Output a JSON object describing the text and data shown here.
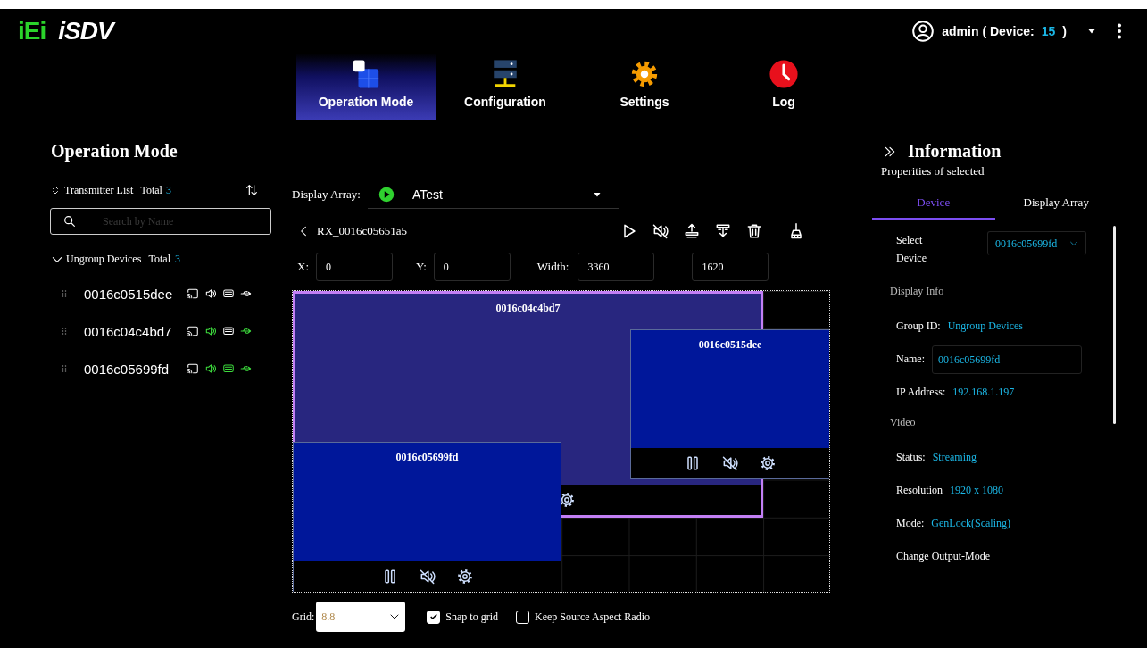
{
  "header": {
    "logo": {
      "brand": "iEi",
      "product": "iSDV"
    },
    "user": {
      "label": "admin ( Device:",
      "count": "15",
      "close": ")"
    }
  },
  "nav_tabs": [
    {
      "kind": "operation",
      "label": "Operation Mode",
      "selected": true
    },
    {
      "kind": "configuration",
      "label": "Configuration",
      "selected": false
    },
    {
      "kind": "settings",
      "label": "Settings",
      "selected": false
    },
    {
      "kind": "log",
      "label": "Log",
      "selected": false
    }
  ],
  "left_panel": {
    "title": "Operation Mode",
    "transmitter_list": {
      "label": "Transmitter List | Total",
      "count": "3"
    },
    "search": {
      "placeholder": "Search by Name"
    },
    "group": {
      "label": "Ungroup Devices | Total",
      "count": "3",
      "expanded": true
    },
    "devices": [
      {
        "name": "0016c0515dee",
        "audio": false,
        "display": false,
        "usb": false
      },
      {
        "name": "0016c04c4bd7",
        "audio": true,
        "display": false,
        "usb": true
      },
      {
        "name": "0016c05699fd",
        "audio": true,
        "display": true,
        "usb": true
      }
    ]
  },
  "display_array": {
    "label": "Display Array:",
    "value": "ATest"
  },
  "receiver": {
    "name": "RX_0016c05651a5"
  },
  "geometry": [
    {
      "label": "X:",
      "value": "0"
    },
    {
      "label": "Y:",
      "value": "0"
    },
    {
      "label": "Width:",
      "value": "3360"
    },
    {
      "value": "1620"
    }
  ],
  "canvas": {
    "windows": [
      {
        "name": "0016c04c4bd7",
        "selected": true,
        "color": "#28267f",
        "controls": [
          {
            "kind": "settings"
          }
        ]
      },
      {
        "name": "0016c0515dee",
        "selected": false,
        "color": "#00179a",
        "controls": [
          {
            "kind": "pause"
          },
          {
            "kind": "mute"
          },
          {
            "kind": "settings"
          }
        ]
      },
      {
        "name": "0016c05699fd",
        "selected": false,
        "color": "#00179a",
        "controls": [
          {
            "kind": "pause"
          },
          {
            "kind": "mute"
          },
          {
            "kind": "settings"
          }
        ]
      }
    ]
  },
  "grid": {
    "label": "Grid:",
    "value": "8.8"
  },
  "options": [
    {
      "label": "Snap to grid",
      "checked": true
    },
    {
      "label": "Keep Source Aspect Radio",
      "checked": false
    }
  ],
  "info_panel": {
    "title": "Information",
    "subtitle": "Properities of selected",
    "tabs": [
      {
        "label": "Device",
        "selected": true
      },
      {
        "label": "Display Array",
        "selected": false
      }
    ],
    "select_device": {
      "label": "Select Device",
      "value": "0016c05699fd"
    },
    "sections": [
      {
        "heading": "Display Info",
        "fields": [
          {
            "kind": "text",
            "label": "Group ID:",
            "value": "Ungroup Devices"
          },
          {
            "kind": "input",
            "label": "Name:",
            "value": "0016c05699fd"
          },
          {
            "kind": "text",
            "label": "IP Address:",
            "value": "192.168.1.197"
          }
        ]
      },
      {
        "heading": "Video",
        "fields": [
          {
            "kind": "text",
            "label": "Status:",
            "value": "Streaming"
          },
          {
            "kind": "text",
            "label": "Resolution",
            "value": "1920 x 1080"
          },
          {
            "kind": "text",
            "label": "Mode:",
            "value": "GenLock(Scaling)"
          },
          {
            "kind": "label",
            "label": "Change Output-Mode"
          }
        ]
      }
    ]
  }
}
